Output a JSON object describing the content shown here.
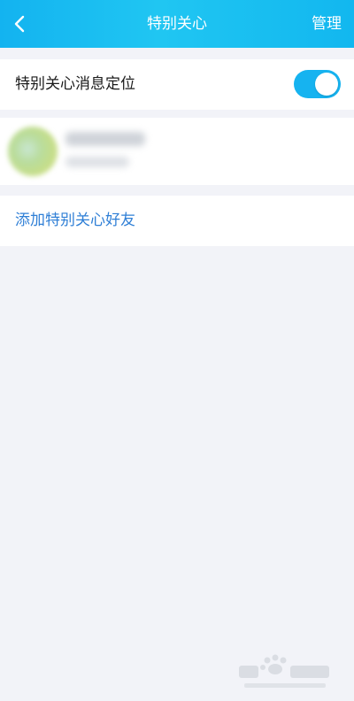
{
  "header": {
    "title": "特别关心",
    "manage_label": "管理",
    "back_icon": "chevron-left-icon",
    "background_color": "#18b9f0"
  },
  "settings": {
    "location_toggle": {
      "label": "特别关心消息定位",
      "enabled": true,
      "on_color": "#16b3f0"
    }
  },
  "friends": [
    {
      "icon": "avatar-blurred"
    }
  ],
  "actions": {
    "add_label": "添加特别关心好友",
    "link_color": "#2f7fd6"
  },
  "page": {
    "background_color": "#f2f3f8"
  }
}
